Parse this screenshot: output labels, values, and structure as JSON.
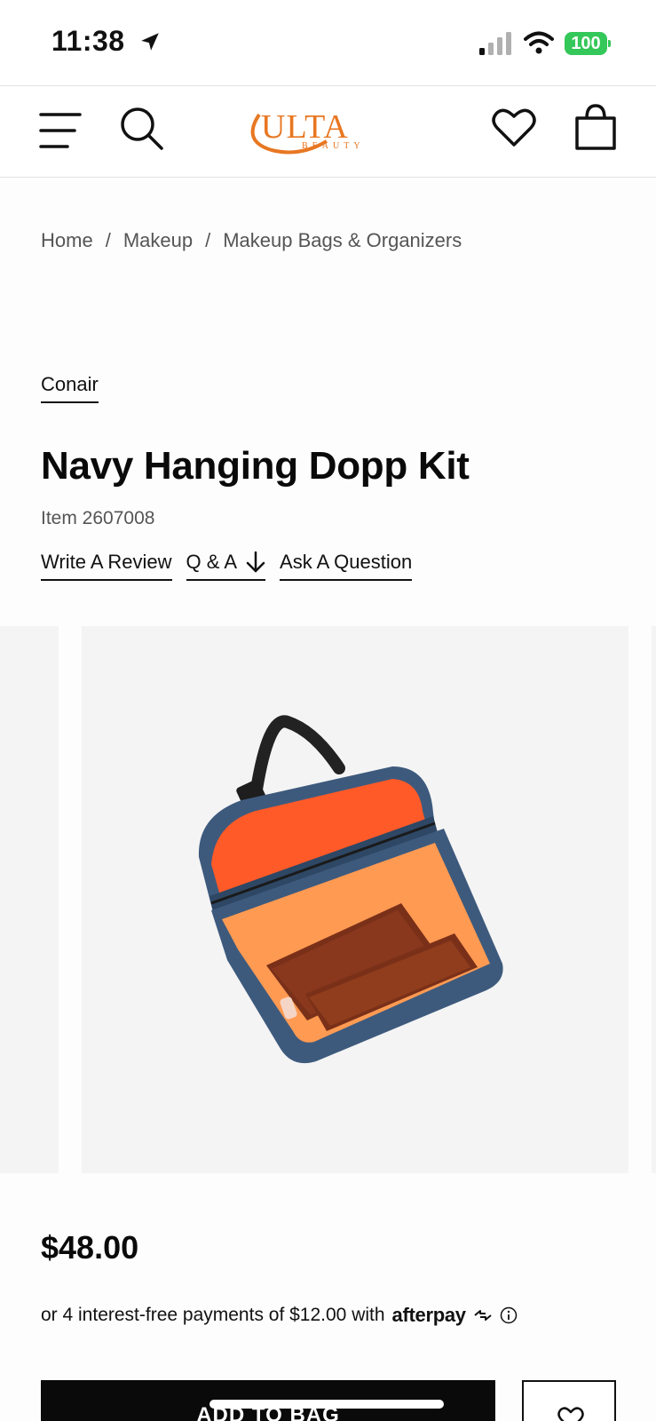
{
  "status_bar": {
    "time": "11:38",
    "battery": "100",
    "icons": [
      "location-arrow-icon",
      "cellular-signal-icon",
      "wifi-icon",
      "battery-icon"
    ]
  },
  "header": {
    "logo_text": "ULTA",
    "logo_subtext": "BEAUTY",
    "icons": [
      "menu-icon",
      "search-icon",
      "heart-icon",
      "shopping-bag-icon"
    ]
  },
  "breadcrumb": {
    "items": [
      "Home",
      "Makeup",
      "Makeup Bags & Organizers"
    ],
    "separator": "/"
  },
  "product": {
    "brand": "Conair",
    "title": "Navy Hanging Dopp Kit",
    "item_number": "Item 2607008",
    "actions": {
      "write_review": "Write A Review",
      "qa": "Q & A",
      "ask_question": "Ask A Question"
    },
    "price": "$48.00",
    "afterpay": {
      "text": "or 4 interest-free payments of $12.00 with",
      "brand": "afterpay"
    },
    "add_to_bag": "ADD TO BAG"
  },
  "colors": {
    "brand_orange": "#e87722",
    "bag_navy": "#3d5a7d",
    "bag_lining": "#ff7a3d",
    "afterpay_green": "#34c759",
    "text_primary": "#0a0a0a",
    "text_secondary": "#555555"
  }
}
